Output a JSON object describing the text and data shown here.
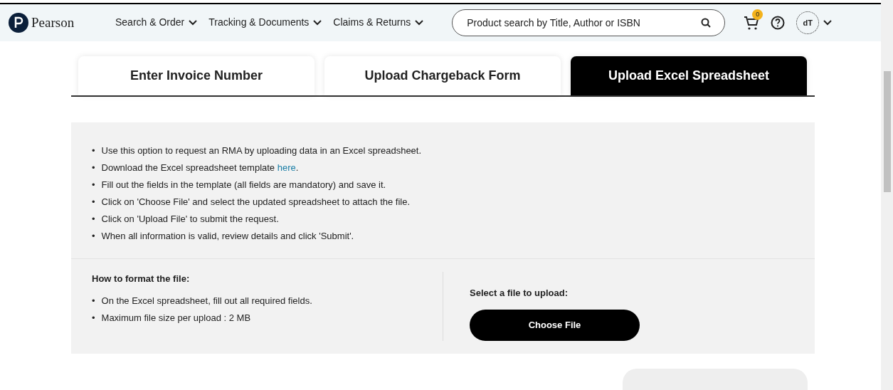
{
  "header": {
    "logo": "Pearson",
    "nav": [
      {
        "label": "Search & Order"
      },
      {
        "label": "Tracking & Documents"
      },
      {
        "label": "Claims & Returns"
      }
    ],
    "search": {
      "placeholder": "Product search by Title, Author or ISBN"
    },
    "cart_count": "0",
    "avatar": "dT"
  },
  "tabs": [
    {
      "label": "Enter Invoice Number",
      "selected": false
    },
    {
      "label": "Upload Chargeback Form",
      "selected": false
    },
    {
      "label": "Upload Excel Spreadsheet",
      "selected": true
    }
  ],
  "instructions": [
    {
      "bullet": "•",
      "text": "Use this option to request an RMA by uploading data in an Excel spreadsheet."
    },
    {
      "bullet": "•",
      "text": "Download the Excel spreadsheet template ",
      "link": "here",
      "after": "."
    },
    {
      "bullet": "•",
      "text": "Fill out the fields in the template (all fields are mandatory) and save it."
    },
    {
      "bullet": "•",
      "text": "Click on 'Choose File' and select the updated spreadsheet to attach the file."
    },
    {
      "bullet": "•",
      "text": "Click on 'Upload File' to submit the request."
    },
    {
      "bullet": "•",
      "text": "When all information is valid, review details and click 'Submit'."
    }
  ],
  "format": {
    "title": "How to format the file:",
    "items": [
      {
        "bullet": "•",
        "text": "On the Excel spreadsheet, fill out all required fields."
      },
      {
        "bullet": "•",
        "text": "Maximum file size per upload : 2 MB"
      }
    ]
  },
  "upload": {
    "title": "Select a file to upload:",
    "button": "Choose File"
  }
}
